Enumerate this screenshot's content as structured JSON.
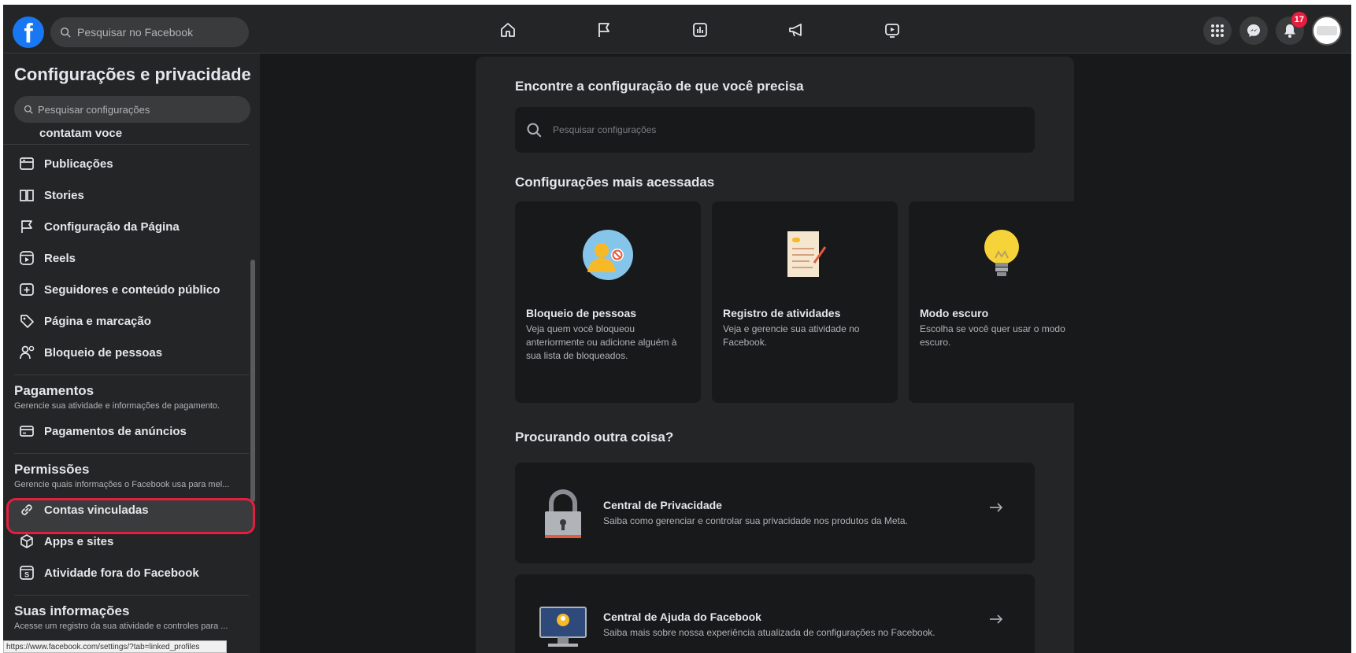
{
  "topbar": {
    "logo_letter": "f",
    "search_placeholder": "Pesquisar no Facebook",
    "notification_count": "17"
  },
  "sidebar": {
    "title": "Configurações e privacidade",
    "search_placeholder": "Pesquisar configurações",
    "partial_item": "contatam voce",
    "items_a": [
      {
        "label": "Publicações",
        "icon": "posts-icon"
      },
      {
        "label": "Stories",
        "icon": "book-icon"
      },
      {
        "label": "Configuração da Página",
        "icon": "flag-icon"
      },
      {
        "label": "Reels",
        "icon": "reels-icon"
      },
      {
        "label": "Seguidores e conteúdo público",
        "icon": "public-icon"
      },
      {
        "label": "Página e marcação",
        "icon": "tag-icon"
      },
      {
        "label": "Bloqueio de pessoas",
        "icon": "block-user-icon"
      }
    ],
    "payments": {
      "title": "Pagamentos",
      "subtitle": "Gerencie sua atividade e informações de pagamento.",
      "item": "Pagamentos de anúncios"
    },
    "permissions": {
      "title": "Permissões",
      "subtitle": "Gerencie quais informações o Facebook usa para mel...",
      "items": [
        "Contas vinculadas",
        "Apps e sites",
        "Atividade fora do Facebook"
      ]
    },
    "your_info": {
      "title": "Suas informações",
      "subtitle": "Acesse um registro da sua atividade e controles para ..."
    },
    "status_url": "https://www.facebook.com/settings/?tab=linked_profiles"
  },
  "main": {
    "find_heading": "Encontre a configuração de que você precisa",
    "search_placeholder": "Pesquisar configurações",
    "most_accessed_heading": "Configurações mais acessadas",
    "cards": [
      {
        "title": "Bloqueio de pessoas",
        "desc": "Veja quem você bloqueou anteriormente ou adicione alguém à sua lista de bloqueados."
      },
      {
        "title": "Registro de atividades",
        "desc": "Veja e gerencie sua atividade no Facebook."
      },
      {
        "title": "Modo escuro",
        "desc": "Escolha se você quer usar o modo escuro."
      }
    ],
    "looking_heading": "Procurando outra coisa?",
    "rows": [
      {
        "title": "Central de Privacidade",
        "desc": "Saiba como gerenciar e controlar sua privacidade nos produtos da Meta."
      },
      {
        "title": "Central de Ajuda do Facebook",
        "desc": "Saiba mais sobre nossa experiência atualizada de configurações no Facebook."
      }
    ]
  },
  "colors": {
    "accent": "#1877f2",
    "badge": "#e41e3f",
    "highlight_ring": "#e41e3f"
  }
}
